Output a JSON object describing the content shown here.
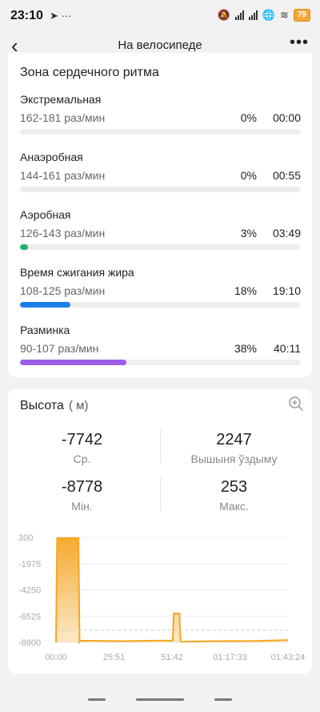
{
  "status": {
    "time": "23:10",
    "battery": "79",
    "left_icons": "➤ ···"
  },
  "nav": {
    "title": "На велосипеде"
  },
  "heart_zones": {
    "title": "Зона сердечного ритма",
    "zones": [
      {
        "name": "Экстремальная",
        "range": "162-181 раз/мин",
        "percent": "0%",
        "time": "00:00",
        "fill": 0,
        "color": "#e04040"
      },
      {
        "name": "Анаэробная",
        "range": "144-161 раз/мин",
        "percent": "0%",
        "time": "00:55",
        "fill": 0,
        "color": "#f29a2e"
      },
      {
        "name": "Аэробная",
        "range": "126-143 раз/мин",
        "percent": "3%",
        "time": "03:49",
        "fill": 0.03,
        "color": "#1db36b"
      },
      {
        "name": "Время сжигания жира",
        "range": "108-125 раз/мин",
        "percent": "18%",
        "time": "19:10",
        "fill": 0.18,
        "color": "#1a7fe8"
      },
      {
        "name": "Разминка",
        "range": "90-107 раз/мин",
        "percent": "38%",
        "time": "40:11",
        "fill": 0.38,
        "color": "#9b5de5"
      }
    ]
  },
  "altitude": {
    "title": "Высота",
    "unit": "( м)",
    "stats": [
      {
        "value": "-7742",
        "label": "Ср."
      },
      {
        "value": "2247",
        "label": "Вышыня ўздыму"
      },
      {
        "value": "-8778",
        "label": "Мін."
      },
      {
        "value": "253",
        "label": "Макс."
      }
    ]
  },
  "chart_data": {
    "type": "area",
    "title": "",
    "xlabel": "",
    "ylabel": "",
    "y_ticks": [
      "300",
      "-1975",
      "-4250",
      "-6525",
      "-8800"
    ],
    "x_ticks": [
      "00:00",
      "25:51",
      "51:42",
      "01:17:33",
      "01:43:24"
    ],
    "ylim": [
      -8800,
      300
    ],
    "xlim_minutes": [
      0,
      103.4
    ],
    "reference_line": -7742,
    "color": "#f5a623",
    "series": [
      {
        "x_minutes": [
          0,
          0.5,
          10,
          10.5,
          11,
          30,
          45,
          52,
          52.5,
          55,
          55.5,
          56,
          70,
          90,
          103.4
        ],
        "values": [
          -8800,
          250,
          250,
          -8770,
          -8650,
          -8700,
          -8650,
          -8650,
          -6300,
          -6300,
          -8700,
          -8750,
          -8700,
          -8680,
          -8600
        ]
      }
    ]
  }
}
